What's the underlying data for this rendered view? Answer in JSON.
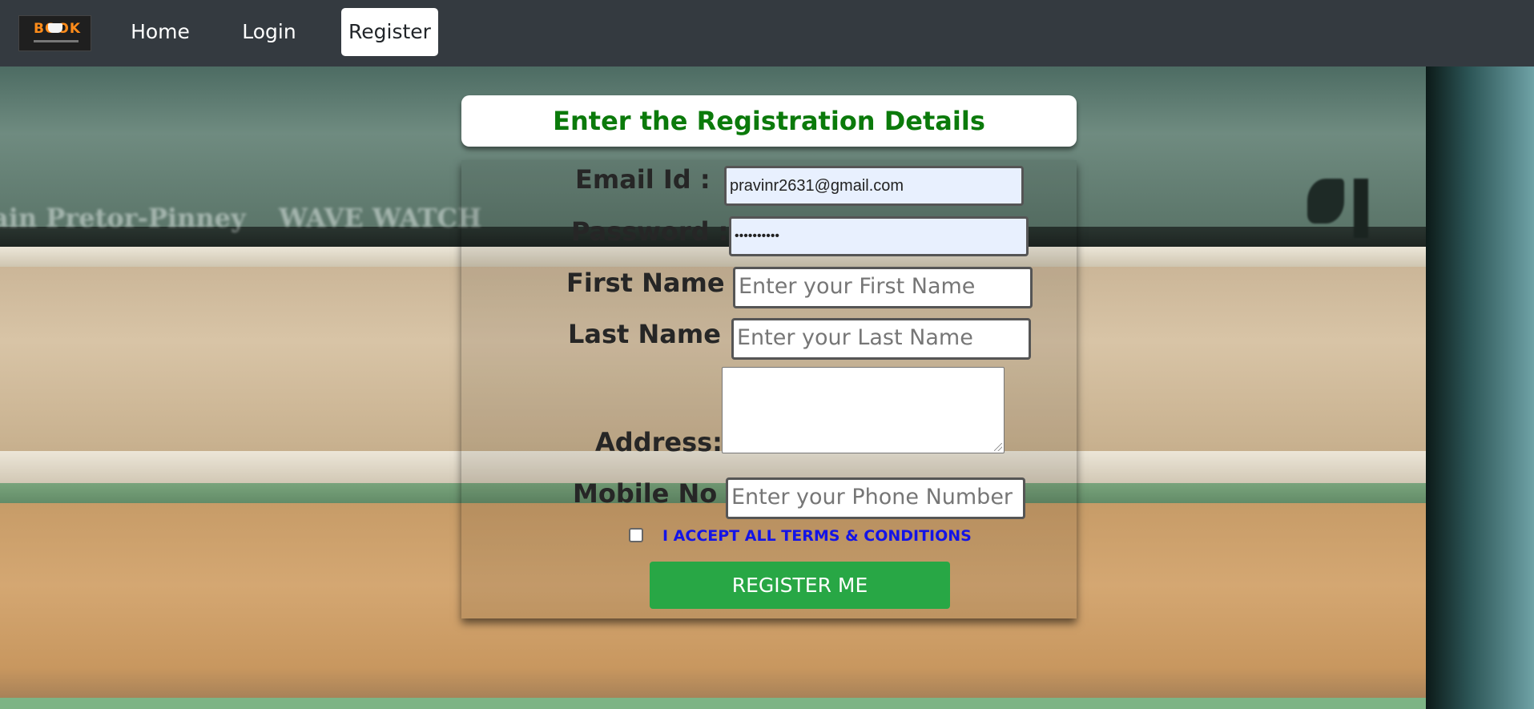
{
  "nav": {
    "logo_text": "BOOK",
    "home_label": "Home",
    "login_label": "Login",
    "register_label": "Register"
  },
  "background": {
    "spine_text_1": "ain Pretor-Pinney",
    "spine_text_2": "WAVE WATCH"
  },
  "form": {
    "title": "Enter the Registration Details",
    "email_label": "Email Id :",
    "email_value": "pravinr2631@gmail.com",
    "password_label": "Password :",
    "password_value": "••••••••••",
    "first_name_label": "First Name :",
    "first_name_placeholder": "Enter your First Name",
    "last_name_label": "Last Name :",
    "last_name_placeholder": "Enter your Last Name",
    "address_label": "Address:",
    "address_value": "",
    "mobile_label": "Mobile No :",
    "mobile_placeholder": "Enter your Phone Number",
    "terms_label": "I ACCEPT ALL TERMS & CONDITIONS",
    "terms_checked": false,
    "submit_label": "REGISTER ME"
  },
  "colors": {
    "navbar": "#343a40",
    "title_text": "#0b7a0b",
    "terms_text": "#1414e6",
    "submit_button": "#28a745",
    "autofill_background": "#e8f0fe"
  }
}
